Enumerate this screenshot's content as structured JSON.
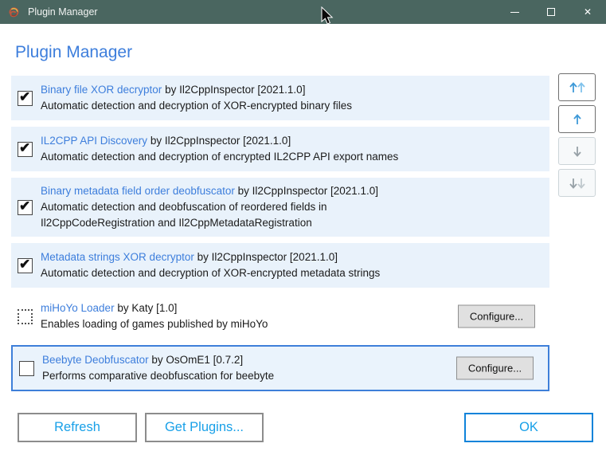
{
  "titlebar": {
    "app_title": "Plugin Manager",
    "close_glyph": "✕"
  },
  "header": {
    "title": "Plugin Manager"
  },
  "icons": {
    "check_glyph": "✔",
    "app_icon": "il2cppinspector-logo-icon",
    "list_controls": {
      "move_to_top": "double-up-arrow-icon",
      "move_up": "up-arrow-icon",
      "move_down": "down-arrow-icon",
      "move_to_bottom": "double-down-arrow-icon"
    }
  },
  "plugins": [
    {
      "name": "Binary file XOR decryptor",
      "byline": "by Il2CppInspector [2021.1.0]",
      "description": "Automatic detection and decryption of XOR-encrypted binary files",
      "checked": true,
      "selected": false,
      "has_configure": false
    },
    {
      "name": "IL2CPP API Discovery",
      "byline": "by Il2CppInspector [2021.1.0]",
      "description": "Automatic detection and decryption of encrypted IL2CPP API export names",
      "checked": true,
      "selected": false,
      "has_configure": false
    },
    {
      "name": "Binary metadata field order deobfuscator",
      "byline": "by Il2CppInspector [2021.1.0]",
      "description": "Automatic detection and deobfuscation of reordered fields in\nIl2CppCodeRegistration and Il2CppMetadataRegistration",
      "checked": true,
      "selected": false,
      "has_configure": false
    },
    {
      "name": "Metadata strings XOR decryptor",
      "byline": "by Il2CppInspector [2021.1.0]",
      "description": "Automatic detection and decryption of XOR-encrypted metadata strings",
      "checked": true,
      "selected": false,
      "has_configure": false
    },
    {
      "name": "miHoYo Loader",
      "byline": "by Katy [1.0]",
      "description": "Enables loading of games published by miHoYo",
      "checked": false,
      "selected": false,
      "has_configure": true,
      "checkbox_style": "dashed"
    },
    {
      "name": "Beebyte Deobfuscator",
      "byline": "by OsOmE1 [0.7.2]",
      "description": "Performs comparative deobfuscation for beebyte",
      "checked": false,
      "selected": true,
      "has_configure": true
    }
  ],
  "configure_label": "Configure...",
  "footer": {
    "refresh": "Refresh",
    "get_plugins": "Get Plugins...",
    "ok": "OK"
  },
  "colors": {
    "titlebar": "#4a6660",
    "accent_blue": "#3d7edc",
    "footer_button_text": "#18a0e8",
    "row_background": "#e9f2fb",
    "selected_row_border": "#3e7fd9",
    "ok_border": "#0e83da"
  }
}
